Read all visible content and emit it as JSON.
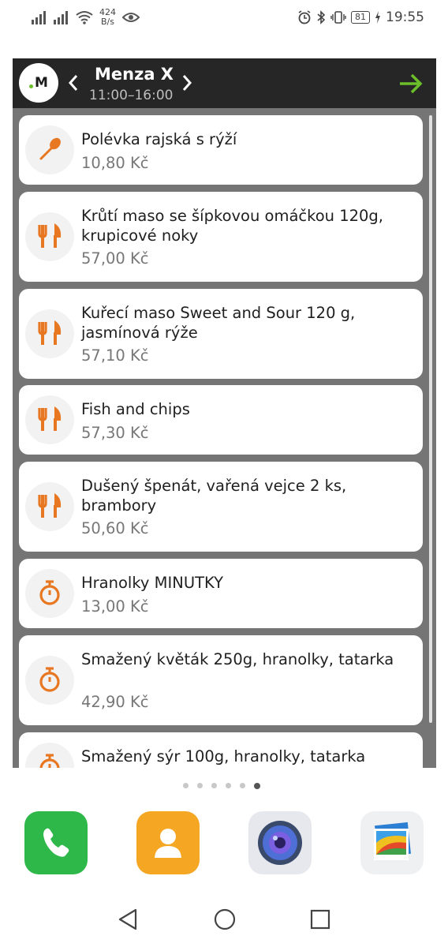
{
  "status_bar": {
    "net_speed_value": "424",
    "net_speed_unit": "B/s",
    "battery": "81",
    "time": "19:55"
  },
  "widget": {
    "canteen_name": "Menza X",
    "hours": "11:00–16:00",
    "accent_color": "#e87722",
    "go_arrow_color": "#6cbf2a",
    "logo_text": "M"
  },
  "menu": [
    {
      "icon": "spoon-icon",
      "title": "Polévka rajská s rýží",
      "price": "10,80 Kč"
    },
    {
      "icon": "fork-knife-icon",
      "title": "Krůtí maso se šípkovou omáčkou 120g, krupicové noky",
      "price": "57,00 Kč"
    },
    {
      "icon": "fork-knife-icon",
      "title": "Kuřecí maso Sweet and Sour 120 g, jasmínová rýže",
      "price": "57,10 Kč"
    },
    {
      "icon": "fork-knife-icon",
      "title": "Fish and chips",
      "price": "57,30 Kč"
    },
    {
      "icon": "fork-knife-icon",
      "title": "Dušený špenát, vařená vejce 2 ks, brambory",
      "price": "50,60 Kč"
    },
    {
      "icon": "stopwatch-icon",
      "title": "Hranolky MINUTKY",
      "price": "13,00 Kč"
    },
    {
      "icon": "stopwatch-icon",
      "title": "Smažený květák 250g, hranolky, tatarka",
      "price": "42,90 Kč"
    },
    {
      "icon": "stopwatch-icon",
      "title": "Smažený sýr 100g, hranolky, tatarka",
      "price": ""
    }
  ],
  "pager": {
    "count": 6,
    "active": 6
  },
  "dock": [
    "phone-app",
    "contacts-app",
    "camera-app",
    "gallery-app"
  ]
}
